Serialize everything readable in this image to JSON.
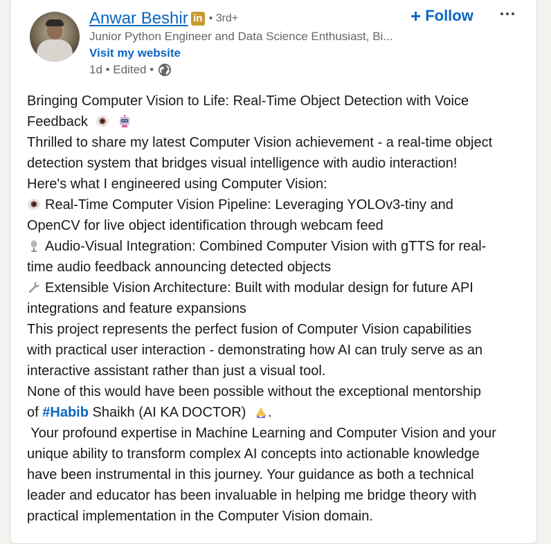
{
  "author": {
    "name": "Anwar Beshir",
    "badge": "in",
    "degree": "• 3rd+",
    "headline": "Junior Python Engineer and Data Science Enthusiast, Bi...",
    "website_label": "Visit my website",
    "meta": "1d • Edited •"
  },
  "actions": {
    "follow_label": "Follow",
    "follow_plus": "+"
  },
  "post": {
    "line1": "Bringing Computer Vision to Life: Real-Time Object Detection with Voice",
    "line2": "Feedback",
    "line3": "Thrilled to share my latest Computer Vision achievement - a real-time object",
    "line4": "detection system that bridges visual intelligence with audio interaction!",
    "line5": "Here's what I engineered using Computer Vision:",
    "line6": "Real-Time Computer Vision Pipeline: Leveraging YOLOv3-tiny and",
    "line7": "OpenCV for live object identification through webcam feed",
    "line8": "Audio-Visual Integration: Combined Computer Vision with gTTS for real-",
    "line9": "time audio feedback announcing detected objects",
    "line10": "Extensible Vision Architecture: Built with modular design for future API",
    "line11": "integrations and feature expansions",
    "line12": "This project represents the perfect fusion of Computer Vision capabilities",
    "line13": "with practical user interaction - demonstrating how AI can truly serve as an",
    "line14": "interactive assistant rather than just a visual tool.",
    "line15": "None of this would have been possible without the exceptional mentorship",
    "line16_pre": "of ",
    "line16_hashtag": "#Habib",
    "line16_post": " Shaikh (AI KA DOCTOR)",
    "line16_end": ".",
    "line17": " Your profound expertise in Machine Learning and Computer Vision and your",
    "line18": "unique ability to transform complex AI concepts into actionable knowledge",
    "line19": "have been instrumental in this journey. Your guidance as both a technical",
    "line20": "leader and educator has been invaluable in helping me bridge theory with",
    "line21": "practical implementation in the Computer Vision domain."
  },
  "colors": {
    "link": "#0a66c2",
    "text": "#191919",
    "muted": "#666666",
    "badge": "#c79a2e"
  }
}
